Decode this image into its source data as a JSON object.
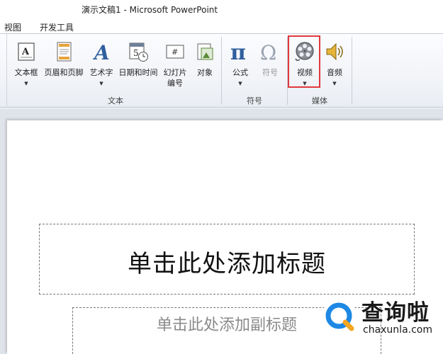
{
  "window": {
    "title": "演示文稿1 - Microsoft PowerPoint"
  },
  "tabs": [
    {
      "label": "视图"
    },
    {
      "label": "开发工具"
    }
  ],
  "ribbon": {
    "groups": {
      "text": {
        "label": "文本"
      },
      "symbols": {
        "label": "符号"
      },
      "media": {
        "label": "媒体"
      }
    },
    "buttons": {
      "textbox": {
        "label": "文本框",
        "icon": "textbox-icon"
      },
      "header_footer": {
        "label": "页眉和页脚",
        "icon": "header-footer-icon"
      },
      "wordart": {
        "label": "艺术字",
        "icon": "wordart-icon"
      },
      "datetime": {
        "label": "日期和时间",
        "icon": "calendar-clock-icon"
      },
      "slide_number": {
        "label_line1": "幻灯片",
        "label_line2": "编号",
        "icon": "slide-number-icon"
      },
      "object": {
        "label": "对象",
        "icon": "object-icon"
      },
      "equation": {
        "label": "公式",
        "icon": "pi-icon"
      },
      "symbol": {
        "label": "符号",
        "icon": "omega-icon",
        "disabled": true
      },
      "video": {
        "label": "视频",
        "icon": "film-reel-icon",
        "highlighted": true
      },
      "audio": {
        "label": "音频",
        "icon": "speaker-icon"
      }
    }
  },
  "slide": {
    "title_placeholder": "单击此处添加标题",
    "subtitle_placeholder": "单击此处添加副标题"
  },
  "watermark": {
    "name": "查询啦",
    "url": "chaxunla.com"
  },
  "colors": {
    "highlight_border": "#e0393e",
    "icon_blue": "#2f5f9e",
    "watermark_blue": "#1e88e5"
  }
}
